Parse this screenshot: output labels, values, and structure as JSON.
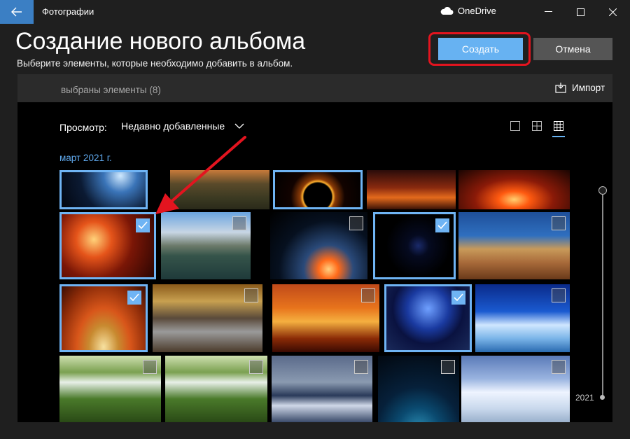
{
  "window": {
    "title": "Фотографии",
    "onedrive": "OneDrive"
  },
  "header": {
    "title": "Создание нового альбома",
    "subtitle": "Выберите элементы, которые необходимо добавить в альбом.",
    "create_label": "Создать",
    "cancel_label": "Отмена"
  },
  "toolbar": {
    "selected": "выбраны элементы (8)",
    "import_label": "Импорт"
  },
  "view": {
    "label": "Просмотр:",
    "value": "Недавно добавленные"
  },
  "timeline": {
    "month": "март 2021 г.",
    "year": "2021"
  },
  "colors": {
    "accent": "#67b2f2",
    "highlight": "#e3141f"
  },
  "photos": [
    {
      "row": 1,
      "col": 1,
      "selected": true,
      "theme": "earth-space"
    },
    {
      "row": 1,
      "col": 2,
      "selected": false,
      "theme": "sunset-road"
    },
    {
      "row": 1,
      "col": 3,
      "selected": true,
      "theme": "eclipse"
    },
    {
      "row": 1,
      "col": 4,
      "selected": false,
      "theme": "fiery-clouds"
    },
    {
      "row": 1,
      "col": 5,
      "selected": false,
      "theme": "red-sunset"
    },
    {
      "row": 2,
      "col": 1,
      "selected": true,
      "theme": "fire-planet"
    },
    {
      "row": 2,
      "col": 2,
      "selected": false,
      "theme": "mountain-lake"
    },
    {
      "row": 2,
      "col": 3,
      "selected": false,
      "theme": "planet-horizon"
    },
    {
      "row": 2,
      "col": 4,
      "selected": true,
      "theme": "crescent-moon"
    },
    {
      "row": 2,
      "col": 5,
      "selected": false,
      "theme": "desert-rock"
    },
    {
      "row": 3,
      "col": 1,
      "selected": true,
      "theme": "orange-planet"
    },
    {
      "row": 3,
      "col": 2,
      "selected": false,
      "theme": "autumn-stream"
    },
    {
      "row": 3,
      "col": 3,
      "selected": false,
      "theme": "alien-city"
    },
    {
      "row": 3,
      "col": 4,
      "selected": true,
      "theme": "blue-planet"
    },
    {
      "row": 3,
      "col": 5,
      "selected": false,
      "theme": "ice-waterfall"
    },
    {
      "row": 4,
      "col": 1,
      "selected": false,
      "theme": "green-waterfall"
    },
    {
      "row": 4,
      "col": 2,
      "selected": false,
      "theme": "green-waterfall"
    },
    {
      "row": 4,
      "col": 3,
      "selected": false,
      "theme": "winter-river"
    },
    {
      "row": 4,
      "col": 4,
      "selected": false,
      "theme": "blue-space"
    },
    {
      "row": 4,
      "col": 5,
      "selected": false,
      "theme": "snowy-field"
    }
  ]
}
